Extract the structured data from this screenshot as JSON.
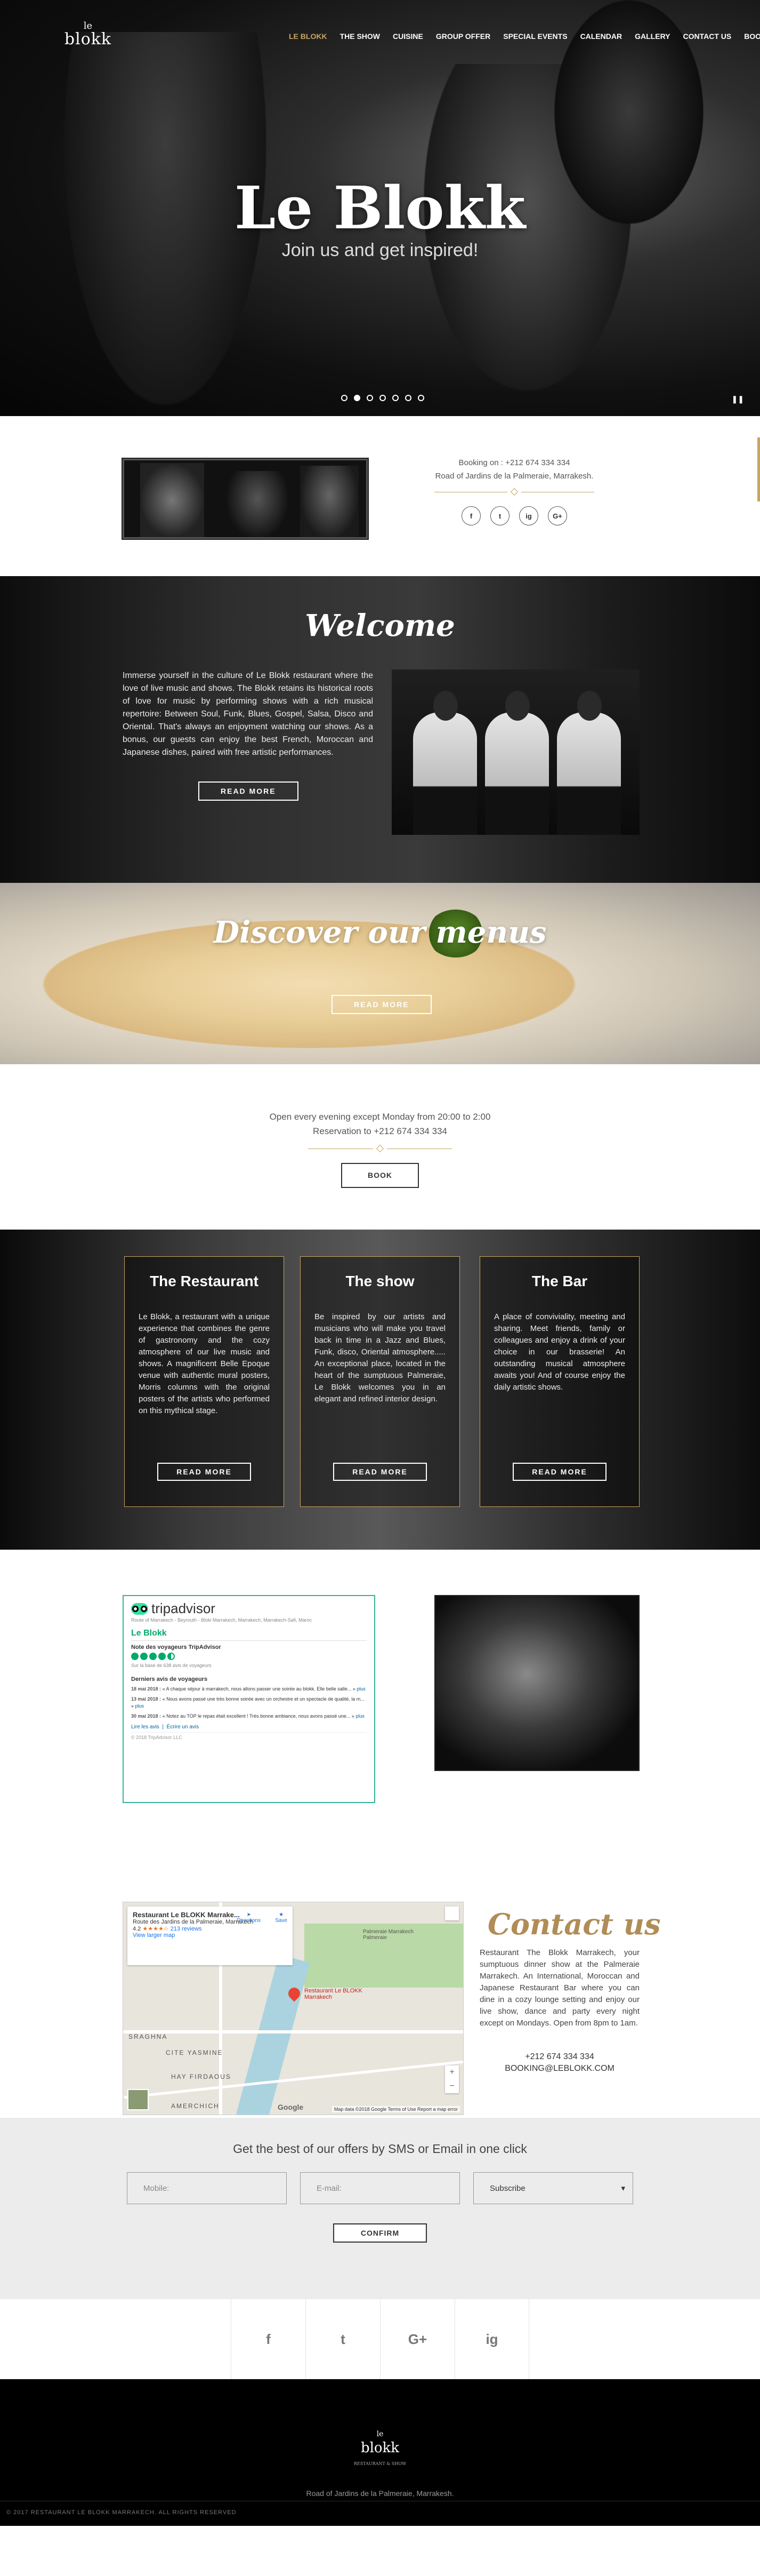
{
  "nav": {
    "logo_top": "le",
    "logo_main": "blokk",
    "items": [
      {
        "label": "LE BLOKK",
        "active": true
      },
      {
        "label": "THE SHOW"
      },
      {
        "label": "CUISINE"
      },
      {
        "label": "GROUP OFFER"
      },
      {
        "label": "SPECIAL EVENTS"
      },
      {
        "label": "CALENDAR"
      },
      {
        "label": "GALLERY"
      },
      {
        "label": "CONTACT US"
      },
      {
        "label": "BOOKING"
      }
    ]
  },
  "hero": {
    "title": "Le Blokk",
    "subtitle": "Join us and get inspired!",
    "slides": 7,
    "active_slide": 2
  },
  "info": {
    "booking": "Booking on : +212 674 334 334",
    "address": "Road of Jardins de la Palmeraie, Marrakesh.",
    "socials": [
      "f",
      "t",
      "ig",
      "G+"
    ]
  },
  "welcome": {
    "title": "Welcome",
    "text": "Immerse yourself in the culture of Le Blokk restaurant where the love of live music and shows. The Blokk retains its historical roots of love for music by performing shows with a rich musical repertoire: Between Soul, Funk, Blues, Gospel, Salsa, Disco and Oriental. That's always an enjoyment watching our shows. As a bonus, our guests can enjoy the best French, Moroccan and Japanese dishes, paired with free artistic performances.",
    "button": "READ MORE"
  },
  "menus": {
    "title": "Discover our menus",
    "button": "READ MORE"
  },
  "hours": {
    "line1": "Open every evening except Monday from 20:00 to 2:00",
    "line2": "Reservation to +212 674 334 334",
    "button": "BOOK"
  },
  "cards": [
    {
      "title": "The Restaurant",
      "text": "Le Blokk, a restaurant with a unique experience that combines the genre of gastronomy and the cozy atmosphere of our live music and shows. A magnificent Belle Epoque venue with authentic mural posters, Morris columns with the original posters of the artists who performed on this mythical stage.",
      "button": "READ MORE"
    },
    {
      "title": "The show",
      "text": "Be inspired by our artists and musicians who will make you travel back in time in a Jazz and Blues, Funk, disco, Oriental atmosphere..... An exceptional place, located in the heart of the sumptuous Palmeraie, Le Blokk welcomes you in an elegant and refined interior design.",
      "button": "READ MORE"
    },
    {
      "title": "The Bar",
      "text": "A place of conviviality, meeting and sharing. Meet friends, family or colleagues and enjoy a drink of your choice in our brasserie! An outstanding musical atmosphere awaits you! And of course enjoy the daily artistic shows.",
      "button": "READ MORE"
    }
  ],
  "tripadvisor": {
    "brand": "tripadvisor",
    "header_note": "Route of Marrakech - Beyrouth - Bloki Marrakech, Marrakech, Marrakech-Safi, Maroc",
    "name": "Le Blokk",
    "rating_label": "Note des voyageurs TripAdvisor",
    "rating": 4.5,
    "reviews_count": "Sur la base de 638 avis de voyageurs",
    "recent_label": "Derniers avis de voyageurs",
    "reviews": [
      {
        "date": "18 mai 2018 :",
        "text": "« A chaque séjour à marrakech, nous allons passer une soirée au blokk. Elle belle salle... »",
        "more": "plus"
      },
      {
        "date": "13 mai 2018 :",
        "text": "« Nous avons passé une très bonne soirée avec un orchestre et un spectacle de qualité, la m... »",
        "more": "plus"
      },
      {
        "date": "30 mai 2018 :",
        "text": "« Notez au TOP le repas était excellent ! Très bonne ambiance, nous avons passé une... »",
        "more": "plus"
      }
    ],
    "link_read": "Lire les avis",
    "link_write": "Écrire un avis",
    "copyright": "© 2018 TripAdvisor LLC"
  },
  "map": {
    "place": "Restaurant Le BLOKK Marrake...",
    "address": "Route des Jardins de la Palmeraie, Marrakech",
    "rating": "4.2",
    "stars": "★★★★☆",
    "reviews": "213 reviews",
    "larger": "View larger map",
    "directions": "Directions",
    "save": "Save",
    "pin_label": "Restaurant Le BLOKK Marrakech",
    "area1": "Palmeraie Marrakech Palmeraie",
    "area2": "SRAGHNA",
    "area3": "CITE YASMINE",
    "area4": "HAY FIRDAOUS",
    "area5": "AMERCHICH",
    "google": "Google",
    "terms": "Map data ©2018 Google    Terms of Use    Report a map error"
  },
  "contact": {
    "title": "Contact us",
    "text": "Restaurant The Blokk Marrakech, your sumptuous dinner show at the Palmeraie Marrakech. An International, Moroccan and Japanese Restaurant Bar where you can dine in a cozy lounge setting and enjoy our live show, dance and party every night except on Mondays. Open from 8pm to 1am.",
    "phone": "+212 674 334 334",
    "email": "BOOKING@LEBLOKK.COM"
  },
  "newsletter": {
    "title": "Get the best of our offers by SMS or Email in one click",
    "mobile_placeholder": "Mobile:",
    "email_placeholder": "E-mail:",
    "select_value": "Subscribe",
    "button": "CONFIRM"
  },
  "social_row": [
    "f",
    "t",
    "G+",
    "ig"
  ],
  "footer": {
    "logo_top": "le",
    "logo_main": "blokk",
    "tagline": "RESTAURANT & SHOW",
    "address": "Road of Jardins de la Palmeraie, Marrakesh.",
    "copyright": "© 2017 RESTAURANT LE BLOKK MARRAKECH. ALL RIGHTS RESERVED"
  }
}
